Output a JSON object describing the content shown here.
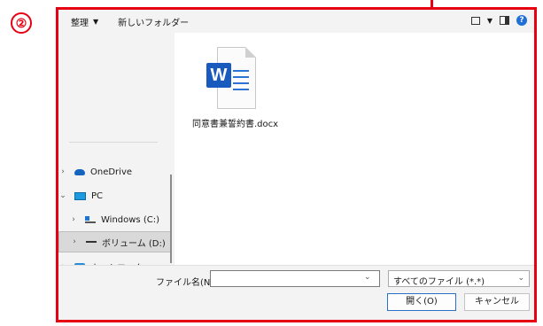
{
  "step_marker": "②",
  "toolbar": {
    "organize_label": "整理",
    "new_folder_label": "新しいフォルダー"
  },
  "nav": {
    "items": [
      {
        "label": "OneDrive",
        "chevron": "›",
        "icon": "cloud-icon"
      },
      {
        "label": "PC",
        "chevron": "⌄",
        "icon": "pc-icon"
      },
      {
        "label": "Windows (C:)",
        "chevron": "›",
        "icon": "drive-icon"
      },
      {
        "label": "ボリューム (D:)",
        "chevron": "›",
        "icon": "volume-icon",
        "selected": true
      },
      {
        "label": "ネットワーク",
        "chevron": "›",
        "icon": "network-icon"
      }
    ]
  },
  "files": [
    {
      "name": "同意書兼誓約書.docx",
      "badge": "W",
      "icon": "word-document-icon"
    }
  ],
  "bottom": {
    "filename_label": "ファイル名(N):",
    "filename_value": "",
    "filetype_value": "すべてのファイル (*.*)",
    "open_label": "開く(O)",
    "cancel_label": "キャンセル"
  },
  "colors": {
    "highlight": "#e60012",
    "word_blue": "#185abd",
    "help_blue": "#1f6fd6"
  }
}
